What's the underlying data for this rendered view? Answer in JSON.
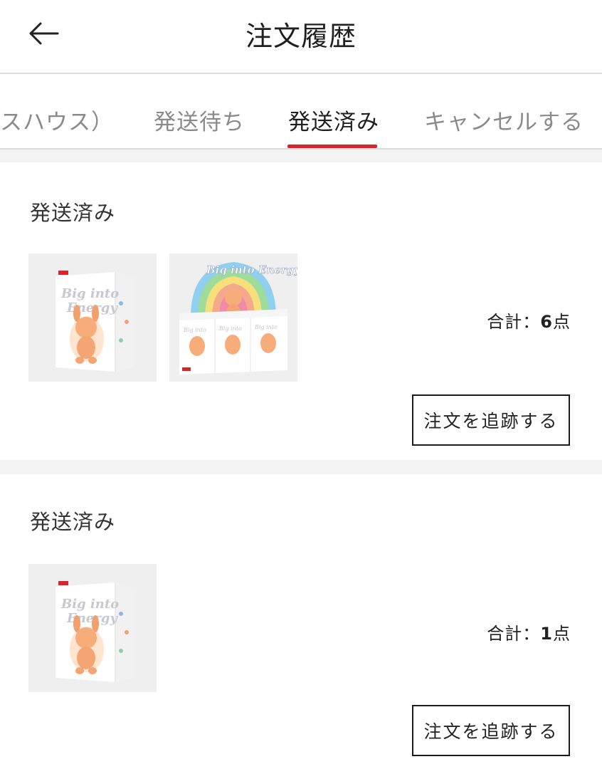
{
  "header": {
    "title": "注文履歴",
    "back_icon": "arrow-left-icon"
  },
  "tabs": [
    {
      "label": "スハウス）",
      "active": false
    },
    {
      "label": "発送待ち",
      "active": false
    },
    {
      "label": "発送済み",
      "active": true
    },
    {
      "label": "キャンセルする",
      "active": false
    }
  ],
  "orders": [
    {
      "status": "発送済み",
      "total_label": "合計：",
      "total_count": "6",
      "total_unit": "点",
      "track_label": "注文を追跡する",
      "products": [
        {
          "type": "single-blind-box",
          "box_text": "Big into Energy"
        },
        {
          "type": "display-box-set",
          "box_text": "Big into Energy"
        }
      ]
    },
    {
      "status": "発送済み",
      "total_label": "合計：",
      "total_count": "1",
      "total_unit": "点",
      "track_label": "注文を追跡する",
      "products": [
        {
          "type": "single-blind-box",
          "box_text": "Big into Energy"
        }
      ]
    }
  ],
  "colors": {
    "accent": "#d4262e",
    "separator": "#f3f3f3",
    "thumb_bg": "#efefef"
  }
}
